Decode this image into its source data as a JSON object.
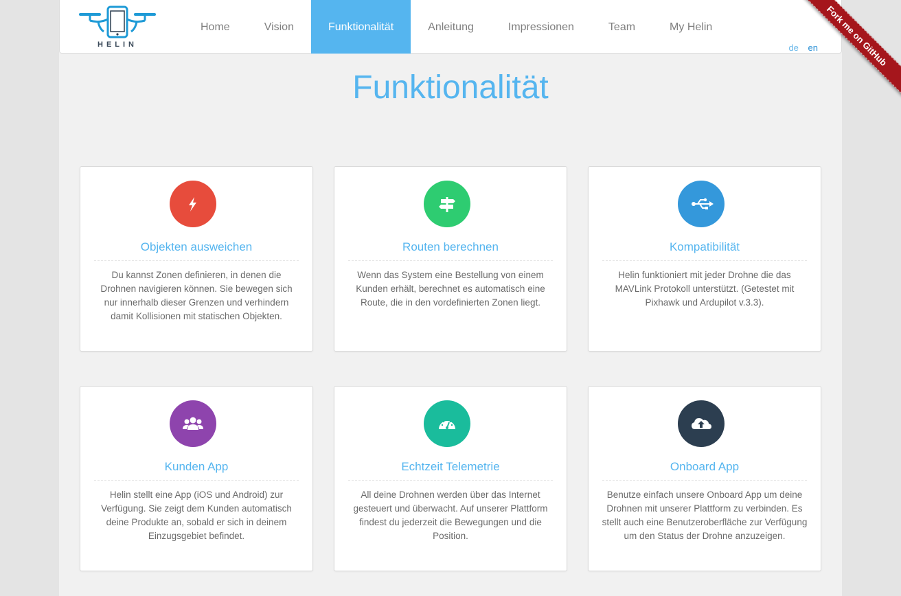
{
  "brand": {
    "name": "HELIN"
  },
  "nav": {
    "items": [
      {
        "label": "Home",
        "active": false
      },
      {
        "label": "Vision",
        "active": false
      },
      {
        "label": "Funktionalität",
        "active": true
      },
      {
        "label": "Anleitung",
        "active": false
      },
      {
        "label": "Impressionen",
        "active": false
      },
      {
        "label": "Team",
        "active": false
      },
      {
        "label": "My Helin",
        "active": false
      }
    ],
    "languages": [
      "de",
      "en"
    ]
  },
  "ribbon": {
    "label": "Fork me on GitHub",
    "color": "#a5161c"
  },
  "page": {
    "title": "Funktionalität",
    "accent": "#55b5ef"
  },
  "features": [
    {
      "title": "Objekten ausweichen",
      "text": "Du kannst Zonen definieren, in denen die Drohnen navigieren können. Sie bewegen sich nur innerhalb dieser Grenzen und verhindern damit Kollisionen mit statischen Objekten.",
      "icon": "lightning-bolt-icon",
      "color": "#e74c3c"
    },
    {
      "title": "Routen berechnen",
      "text": "Wenn das System eine Bestellung von einem Kunden erhält, berechnet es automatisch eine Route, die in den vordefinierten Zonen liegt.",
      "icon": "signpost-icon",
      "color": "#2ecc71"
    },
    {
      "title": "Kompatibilität",
      "text": "Helin funktioniert mit jeder Drohne die das MAVLink Protokoll unterstützt. (Getestet mit Pixhawk und Ardupilot v.3.3).",
      "icon": "usb-icon",
      "color": "#3498db"
    },
    {
      "title": "Kunden App",
      "text": "Helin stellt eine App (iOS und Android) zur Verfügung. Sie zeigt dem Kunden automatisch deine Produkte an, sobald er sich in deinem Einzugsgebiet befindet.",
      "icon": "users-icon",
      "color": "#8e44ad"
    },
    {
      "title": "Echtzeit Telemetrie",
      "text": "All deine Drohnen werden über das Internet gesteuert und überwacht. Auf unserer Plattform findest du jederzeit die Bewegungen und die Position.",
      "icon": "dashboard-icon",
      "color": "#1abc9c"
    },
    {
      "title": "Onboard App",
      "text": "Benutze einfach unsere Onboard App um deine Drohnen mit unserer Plattform zu verbinden. Es stellt auch eine Benutzeroberfläche zur Verfügung um den Status der Drohne anzuzeigen.",
      "icon": "cloud-upload-icon",
      "color": "#2c3e50"
    }
  ]
}
